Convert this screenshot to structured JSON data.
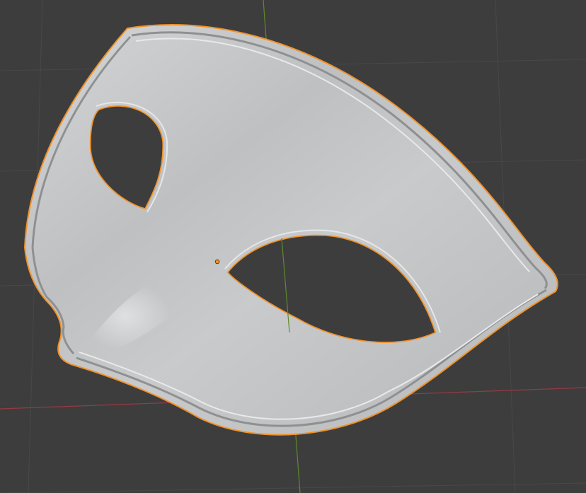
{
  "viewport": {
    "background": "#3d3d3d",
    "grid_color": "#484848",
    "x_axis_color": "#963a44",
    "y_axis_color": "#5f8a2c"
  },
  "object": {
    "semantic": "mask",
    "selected": true,
    "selection_outline_color": "#f0922a",
    "surface_color": "#c6c7c8",
    "origin_color": "#f0922a"
  }
}
